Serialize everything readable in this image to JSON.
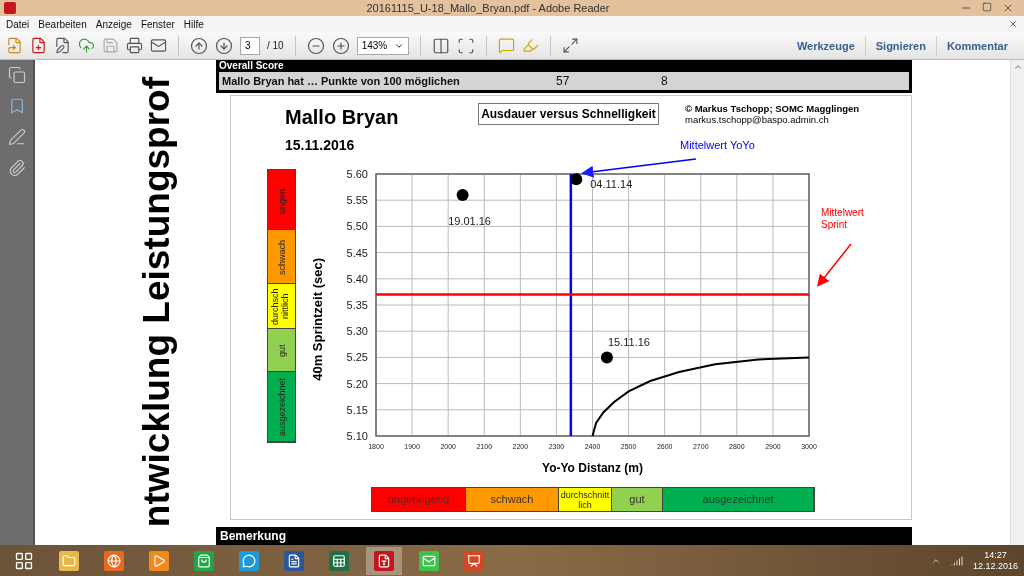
{
  "window": {
    "title": "20161115_U-18_Mallo_Bryan.pdf - Adobe Reader"
  },
  "menu": [
    "Datei",
    "Bearbeiten",
    "Anzeige",
    "Fenster",
    "Hilfe"
  ],
  "toolbar": {
    "page": "3",
    "page_count": "/ 10",
    "zoom": "143%",
    "panels": [
      "Werkzeuge",
      "Signieren",
      "Kommentar"
    ]
  },
  "document": {
    "side_title": "ntwicklung Leistungsprof",
    "overall_score": {
      "heading": "Overall Score",
      "statement": "Mallo Bryan hat … Punkte von 100 möglichen",
      "value_1": "57",
      "value_2": "8"
    },
    "report": {
      "name": "Mallo Bryan",
      "date": "15.11.2016",
      "title": "Ausdauer versus Schnelligkeit",
      "author": "© Markus Tschopp; SOMC Magglingen",
      "email": "markus.tschopp@baspo.admin.ch",
      "rating_scale_vertical": [
        {
          "label": "ungen.",
          "color": "#ff0000"
        },
        {
          "label": "schwach",
          "color": "#ff9900"
        },
        {
          "label": "durchschnittlich",
          "color": "#ffff00"
        },
        {
          "label": "gut",
          "color": "#92d050"
        },
        {
          "label": "ausgezeichnet",
          "color": "#00b050"
        }
      ],
      "chart_data": {
        "type": "scatter",
        "grid": true,
        "xlabel": "Yo-Yo Distanz (m)",
        "ylabel": "40m Sprintzeit (sec)",
        "xlim": [
          1800,
          3000
        ],
        "ylim": [
          5.1,
          5.6
        ],
        "xticks": [
          1800,
          1900,
          2000,
          2100,
          2200,
          2300,
          2400,
          2500,
          2600,
          2700,
          2800,
          2900,
          3000
        ],
        "yticks": [
          {
            "value": 5.1,
            "label": "5.10"
          },
          {
            "value": 5.15,
            "label": "5.15"
          },
          {
            "value": 5.2,
            "label": "5.20"
          },
          {
            "value": 5.25,
            "label": "5.25"
          },
          {
            "value": 5.3,
            "label": "5.30"
          },
          {
            "value": 5.35,
            "label": "5.35"
          },
          {
            "value": 5.4,
            "label": "5.40"
          },
          {
            "value": 5.45,
            "label": "5.45"
          },
          {
            "value": 5.5,
            "label": "5.50"
          },
          {
            "value": 5.55,
            "label": "5.55"
          },
          {
            "value": 5.6,
            "label": "5.60"
          }
        ],
        "series": [
          {
            "color": "#000000",
            "x": [
              2040,
              2355,
              2440
            ],
            "values": [
              5.56,
              5.59,
              5.25
            ],
            "value_labels": [
              "19.01.16",
              "04.11.14",
              "15.11.16"
            ]
          },
          {
            "type": "line",
            "color": "#000000",
            "x": [
              2400,
              2410,
              2430,
              2460,
              2500,
              2560,
              2640,
              2740,
              2860,
              3000
            ],
            "values": [
              5.1,
              5.125,
              5.145,
              5.165,
              5.185,
              5.205,
              5.222,
              5.237,
              5.246,
              5.25
            ]
          }
        ],
        "ref_lines": [
          {
            "axis": "x",
            "value": 2340,
            "color": "#0000ff",
            "label": "Mittelwert YoYo"
          },
          {
            "axis": "y",
            "value": 5.37,
            "color": "#ff0000",
            "label": "Mittelwert Sprint"
          }
        ]
      },
      "rating_scale": [
        {
          "label": "ungenügend",
          "color": "#ff0000"
        },
        {
          "label": "schwach",
          "color": "#ff9900"
        },
        {
          "label": "durchschnittlich",
          "color": "#ffff00"
        },
        {
          "label": "gut",
          "color": "#92d050"
        },
        {
          "label": "ausgezeichnet",
          "color": "#00b050"
        }
      ]
    },
    "remark_heading": "Bemerkung"
  },
  "taskbar": {
    "time": "14:27",
    "date": "12.12.2016"
  }
}
